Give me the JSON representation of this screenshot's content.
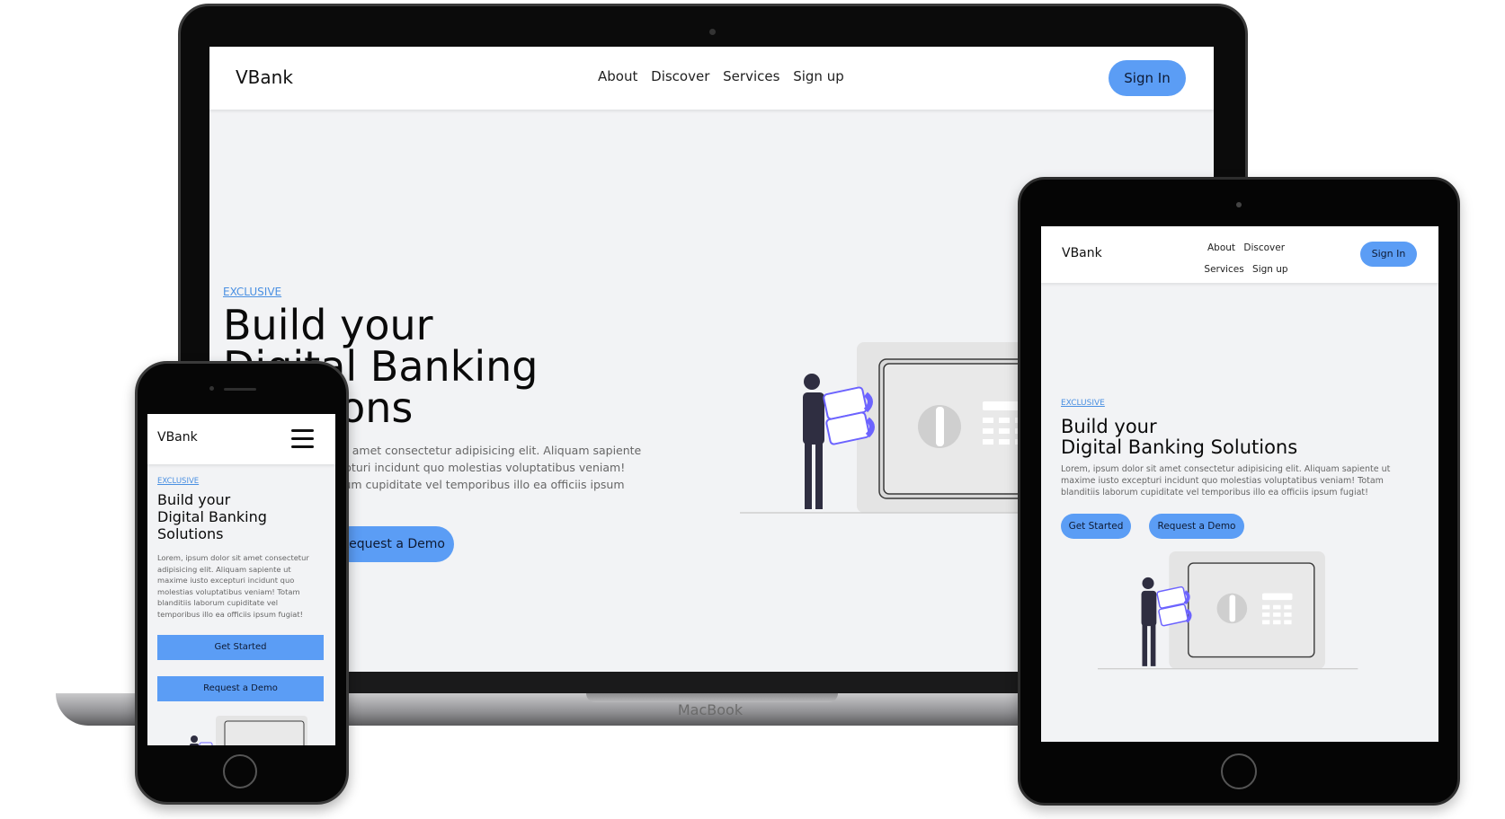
{
  "laptop": {
    "brand": "VBank",
    "nav": [
      "About",
      "Discover",
      "Services",
      "Sign up"
    ],
    "signin": "Sign In",
    "eyebrow": "EXCLUSIVE",
    "headline_1": "Build your",
    "headline_2": "Digital Banking",
    "headline_3": "Solutions",
    "body_1": "Lorem, ipsum dolor sit amet consectetur adipisicing elit. Aliquam sapiente",
    "body_2": "ut maxime iusto excepturi incidunt quo molestias voluptatibus veniam!",
    "body_3": "Totam blanditiis laborum cupiditate vel temporibus illo ea officiis ipsum",
    "demo": "Request a Demo",
    "device_label": "MacBook"
  },
  "tablet": {
    "brand": "VBank",
    "nav": [
      "About",
      "Discover",
      "Services",
      "Sign up"
    ],
    "signin": "Sign In",
    "eyebrow": "EXCLUSIVE",
    "headline_1": "Build your",
    "headline_2": "Digital Banking Solutions",
    "body": "Lorem, ipsum dolor sit amet consectetur adipisicing elit. Aliquam sapiente ut maxime iusto excepturi incidunt quo molestias voluptatibus veniam! Totam blanditiis laborum cupiditate vel temporibus illo ea officiis ipsum fugiat!",
    "get_started": "Get Started",
    "demo": "Request a Demo"
  },
  "phone": {
    "brand": "VBank",
    "eyebrow": "EXCLUSIVE",
    "headline_1": "Build your",
    "headline_2": "Digital Banking",
    "headline_3": "Solutions",
    "body": "Lorem, ipsum dolor sit amet consectetur adipisicing elit. Aliquam sapiente ut maxime iusto excepturi incidunt quo molestias voluptatibus veniam! Totam blanditiis laborum cupiditate vel temporibus illo ea officiis ipsum fugiat!",
    "get_started": "Get Started",
    "demo": "Request a Demo"
  },
  "colors": {
    "accent": "#5b9df5",
    "link": "#4a90e2",
    "illustration_accent": "#6c63ff"
  }
}
